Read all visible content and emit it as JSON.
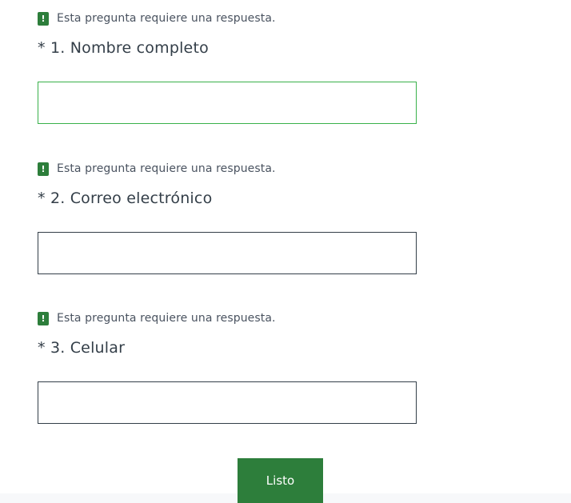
{
  "questions": [
    {
      "error": "Esta pregunta requiere una respuesta.",
      "title": "* 1. Nombre completo",
      "value": ""
    },
    {
      "error": "Esta pregunta requiere una respuesta.",
      "title": "* 2. Correo electrónico",
      "value": ""
    },
    {
      "error": "Esta pregunta requiere una respuesta.",
      "title": "* 3. Celular",
      "value": ""
    }
  ],
  "error_icon": {
    "glyph": "!",
    "name": "exclamation-icon",
    "color": "#2d7e3b"
  },
  "submit": {
    "label": "Listo",
    "color": "#2d7e3b"
  },
  "colors": {
    "focus_border": "#39b14a",
    "input_border": "#333e48",
    "text": "#333e48"
  }
}
